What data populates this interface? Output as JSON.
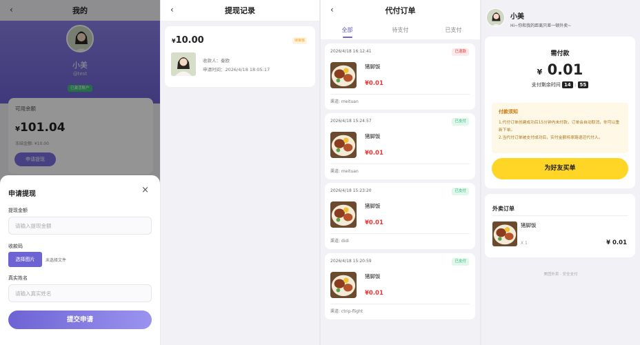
{
  "screen1": {
    "title": "我的",
    "back": "‹",
    "profile": {
      "name": "小美",
      "id": "@test",
      "badge": "已激活账户"
    },
    "balance": {
      "label": "可用余额",
      "currency": "¥",
      "amount": "101.04",
      "sub": "冻结金额: ¥10.00",
      "withdraw_btn": "申请提现"
    },
    "sheet": {
      "title": "申请提现",
      "close": "×",
      "amount_label": "提现金额",
      "amount_placeholder": "请输入提现金额",
      "qrcode_label": "收款码",
      "upload_btn": "选择图片",
      "upload_hint": "未选择文件",
      "name_label": "真实姓名",
      "name_placeholder": "请输入真实姓名",
      "submit": "提交申请"
    }
  },
  "screen2": {
    "title": "提现记录",
    "back": "‹",
    "record": {
      "currency": "¥",
      "amount": "10.00",
      "status": "待审核",
      "payee_label": "收款人：",
      "payee": "秦欧",
      "time_label": "申请时间：",
      "time": "2026/4/18 18:05:17"
    }
  },
  "screen3": {
    "title": "代付订单",
    "back": "‹",
    "tabs": [
      "全部",
      "待支付",
      "已支付"
    ],
    "orders": [
      {
        "time": "2026/4/18 16:12:41",
        "status": "已退款",
        "kind": "refund",
        "name": "猪脚饭",
        "price": "¥0.01",
        "channel": "渠道: meituan"
      },
      {
        "time": "2026/4/18 15:24:57",
        "status": "已支付",
        "kind": "paid",
        "name": "猪脚饭",
        "price": "¥0.01",
        "channel": "渠道: meituan"
      },
      {
        "time": "2026/4/18 15:23:20",
        "status": "已支付",
        "kind": "paid",
        "name": "猪脚饭",
        "price": "¥0.01",
        "channel": "渠道: didi"
      },
      {
        "time": "2026/4/18 15:20:59",
        "status": "已支付",
        "kind": "paid",
        "name": "猪脚饭",
        "price": "¥0.01",
        "channel": "渠道: ctrip-flight"
      }
    ]
  },
  "screen4": {
    "user": {
      "name": "小美",
      "slogan": "Hi~你和我的距离只差一顿外卖~"
    },
    "pay": {
      "title": "需付款",
      "currency": "¥",
      "amount": "0.01",
      "timer_label": "支付剩余时间",
      "minutes": "14",
      "sep": ":",
      "seconds": "55"
    },
    "notice": {
      "title": "付款须知",
      "line1": "1.代付订单创建成功后15分钟内未付款，订单会自动取消，你可以重新下单。",
      "line2": "2.当代付订单被支付成功后，实付金额将原路退还代付人。"
    },
    "friend_btn": "为好友买单",
    "takeout": {
      "title": "外卖订单",
      "name": "猪脚饭",
      "qty": "X 1",
      "price": "¥ 0.01"
    },
    "footer": "美团外卖 · 安全支付"
  },
  "colors": {
    "purple": "#6e63d4",
    "yellow": "#ffd526",
    "red": "#e33333",
    "green": "#2bb673"
  },
  "icons": {
    "back": "chevron-left-icon",
    "close": "close-icon"
  }
}
